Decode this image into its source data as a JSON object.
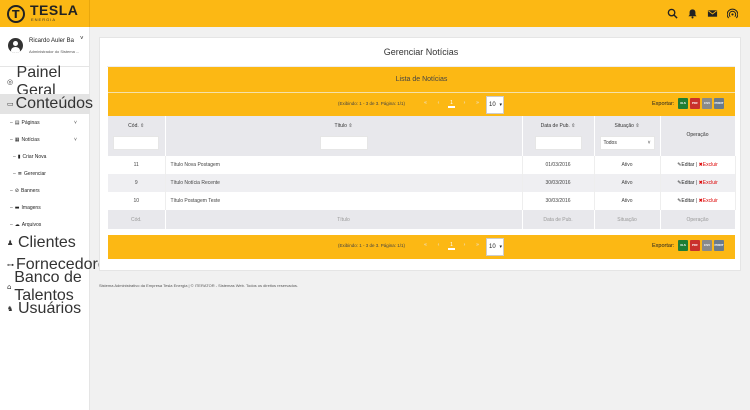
{
  "brand": {
    "name": "TESLA",
    "sub": "ENERGIA"
  },
  "topbar_icons": [
    "search-icon",
    "bell-icon",
    "mail-icon",
    "broadcast-icon"
  ],
  "user": {
    "name": "Ricardo Auler Ba",
    "role": "Administrador do Sistema ..."
  },
  "nav": {
    "painel": "Painel Geral",
    "conteudos": "Conteúdos",
    "paginas": "Páginas",
    "noticias": "Notícias",
    "criar_nova": "Criar Nova",
    "gerenciar": "Gerenciar",
    "banners": "Banners",
    "imagens": "Imagens",
    "arquivos": "Arquivos",
    "clientes": "Clientes",
    "fornecedores": "Fornecedores",
    "banco": "Banco de Talentos",
    "usuarios": "Usuários"
  },
  "page": {
    "title": "Gerenciar Notícias",
    "list_title": "Lista de Notícias"
  },
  "pager": {
    "info": "(Exibindo: 1 - 3 de 3. Página: 1/1)",
    "first": "«",
    "prev": "‹",
    "current": "1",
    "next": "›",
    "last": "»",
    "per_page": "10",
    "export_label": "Exportar:",
    "export_formats": [
      "XLS",
      "PDF",
      "CSV",
      "PRINT"
    ]
  },
  "table": {
    "columns": [
      "Cód.",
      "Título",
      "Data de Pub.",
      "Situação",
      "Operação"
    ],
    "situacao_filter": "Todos",
    "rows": [
      {
        "cod": "11",
        "titulo": "Título Nova Postagem",
        "data": "01/03/2016",
        "situacao": "Ativo"
      },
      {
        "cod": "9",
        "titulo": "Título Notícia Recente",
        "data": "30/03/2016",
        "situacao": "Ativo"
      },
      {
        "cod": "10",
        "titulo": "Título Postagem Teste",
        "data": "30/03/2016",
        "situacao": "Ativo"
      }
    ],
    "edit_label": "Editar",
    "delete_label": "Excluir",
    "sep": "|",
    "footer": [
      "Cód.",
      "Título",
      "Data de Pub.",
      "Situação",
      "Operação"
    ]
  },
  "footer_text": "Sistema Administrativo da Empresa Tesla Energia | © ITERATOR - Sistemas Web. Todos os direitos reservados.",
  "colors": {
    "accent": "#fcb814",
    "active_nav": "#e3e3e3",
    "delete": "#dd0000"
  }
}
